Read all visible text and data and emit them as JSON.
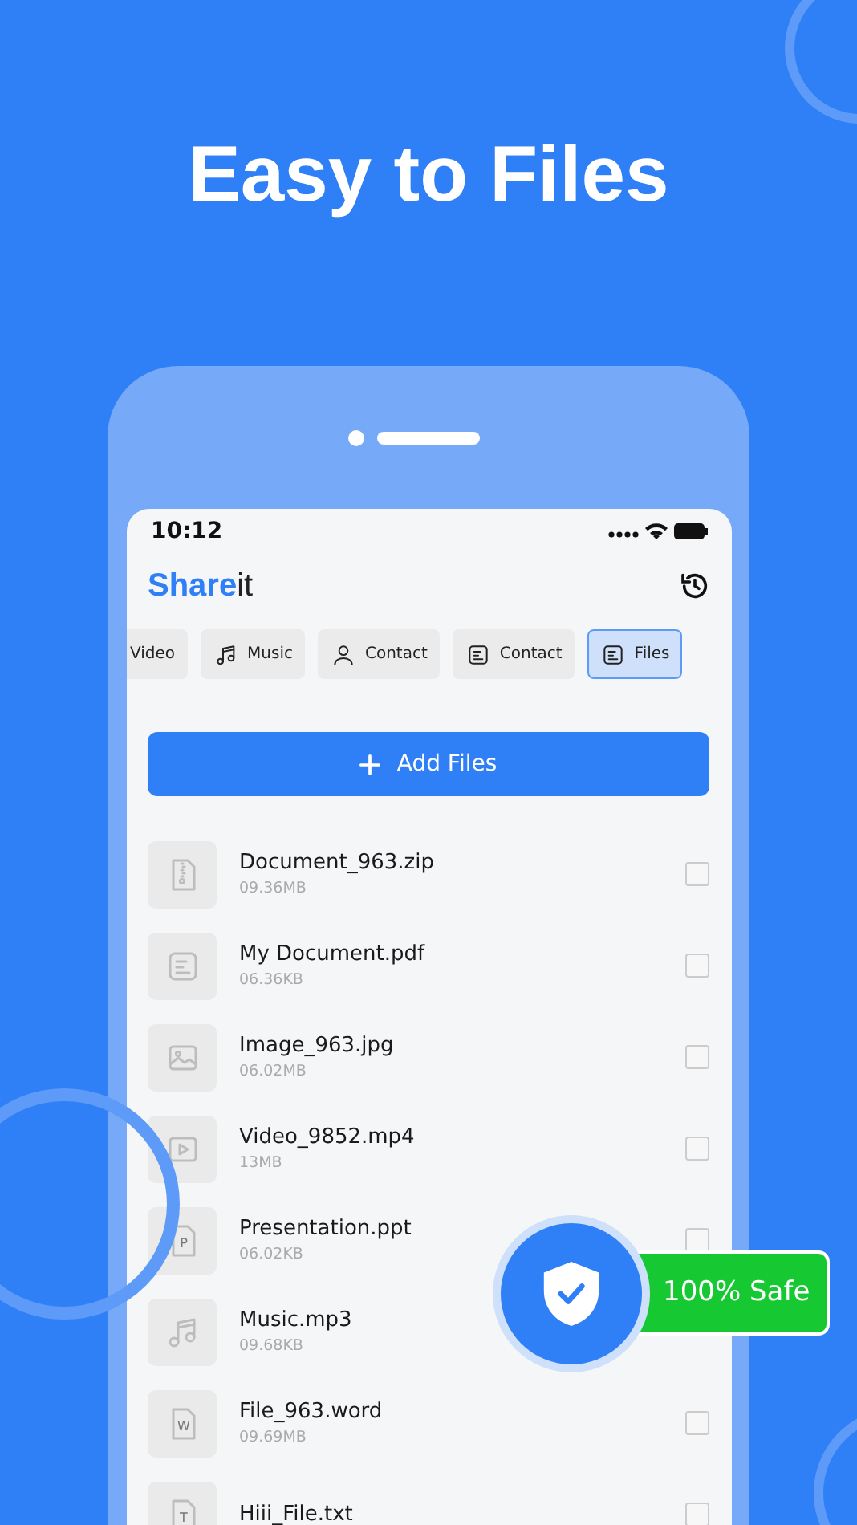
{
  "headline": "Easy to Files",
  "status_bar": {
    "time": "10:12"
  },
  "app": {
    "brand": "Share",
    "brand_suffix": "it"
  },
  "tabs": [
    {
      "label": "Video",
      "selected": false
    },
    {
      "label": "Music",
      "kind": "music",
      "selected": false
    },
    {
      "label": "Contact",
      "kind": "person",
      "selected": false
    },
    {
      "label": "Contact",
      "kind": "doc",
      "selected": false
    },
    {
      "label": "Files",
      "kind": "doc",
      "selected": true
    }
  ],
  "add_button": "Add Files",
  "files": [
    {
      "name": "Document_963.zip",
      "size": "09.36MB",
      "kind": "zip",
      "checked": false
    },
    {
      "name": "My Document.pdf",
      "size": "06.36KB",
      "kind": "doc",
      "checked": false
    },
    {
      "name": "Image_963.jpg",
      "size": "06.02MB",
      "kind": "image",
      "checked": false
    },
    {
      "name": "Video_9852.mp4",
      "size": "13MB",
      "kind": "video",
      "checked": false
    },
    {
      "name": "Presentation.ppt",
      "size": "06.02KB",
      "kind": "letter",
      "letter": "P",
      "checked": false
    },
    {
      "name": "Music.mp3",
      "size": "09.68KB",
      "kind": "music"
    },
    {
      "name": "File_963.word",
      "size": "09.69MB",
      "kind": "letter",
      "letter": "W",
      "checked": false
    },
    {
      "name": "Hiii_File.txt",
      "kind": "letter",
      "letter": "T",
      "checked": false
    }
  ],
  "badge": {
    "label": "100% Safe"
  }
}
